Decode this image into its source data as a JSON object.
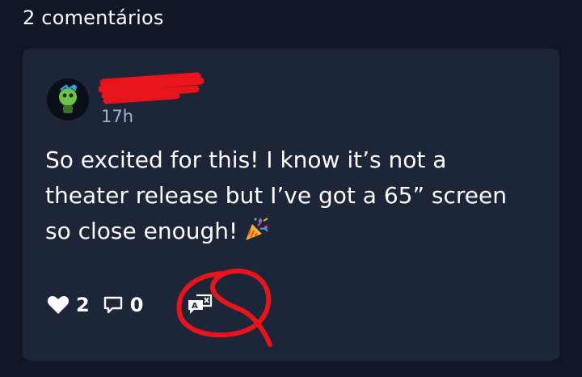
{
  "header": {
    "title": "2 comentários"
  },
  "comment": {
    "timestamp": "17h",
    "body": "So excited for this! I know it’s not a\ntheater release but I’ve got a 65” screen\nso close enough!",
    "emoji_icon": "party-popper-icon",
    "likes_count": "2",
    "replies_count": "0",
    "author_name_redacted": true
  },
  "icons": {
    "like": "heart-icon",
    "reply": "comment-icon",
    "translate": "translate-icon"
  },
  "colors": {
    "page_background": "#101828",
    "card_background": "#1d2638",
    "timestamp_text": "#9fb3cf",
    "annotation_red": "#e8141c",
    "avatar_character": "#6ec24a"
  }
}
